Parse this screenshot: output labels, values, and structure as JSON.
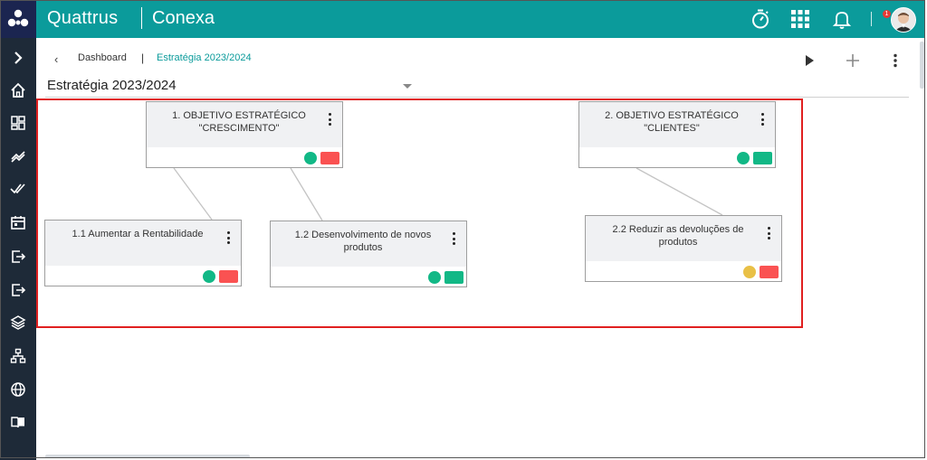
{
  "header": {
    "brand": "Quattrus",
    "product": "Conexa",
    "notification_count": "1",
    "icons": [
      "stopwatch-icon",
      "apps-grid-icon",
      "bell-icon"
    ]
  },
  "sidebar": {
    "items": [
      "expand-icon",
      "home-icon",
      "dashboard-icon",
      "trend-icon",
      "checks-icon",
      "calendar-icon",
      "export-icon",
      "logout-icon",
      "layers-icon",
      "hierarchy-icon",
      "globe-icon",
      "book-icon"
    ]
  },
  "breadcrumb": {
    "back": "‹",
    "parent": "Dashboard",
    "separator": "|",
    "current": "Estratégia 2023/2024"
  },
  "selector": {
    "value": "Estratégia 2023/2024"
  },
  "colors": {
    "header": "#0b9b9b",
    "sidebar": "#1e2a38",
    "green": "#12b886",
    "red": "#fa5252",
    "yellow": "#e9c046",
    "highlight": "#e02020"
  },
  "cards": [
    {
      "title": "1. OBJETIVO ESTRATÉGICO \"CRESCIMENTO\"",
      "dot": "#12b886",
      "flag": "#fa5252"
    },
    {
      "title": "2. OBJETIVO ESTRATÉGICO \"CLIENTES\"",
      "dot": "#12b886",
      "flag": "#12b886"
    },
    {
      "title": "1.1 Aumentar a Rentabilidade",
      "dot": "#12b886",
      "flag": "#fa5252"
    },
    {
      "title": "1.2 Desenvolvimento de novos produtos",
      "dot": "#12b886",
      "flag": "#12b886"
    },
    {
      "title": "2.2 Reduzir as devoluções de produtos",
      "dot": "#e9c046",
      "flag": "#fa5252"
    }
  ]
}
